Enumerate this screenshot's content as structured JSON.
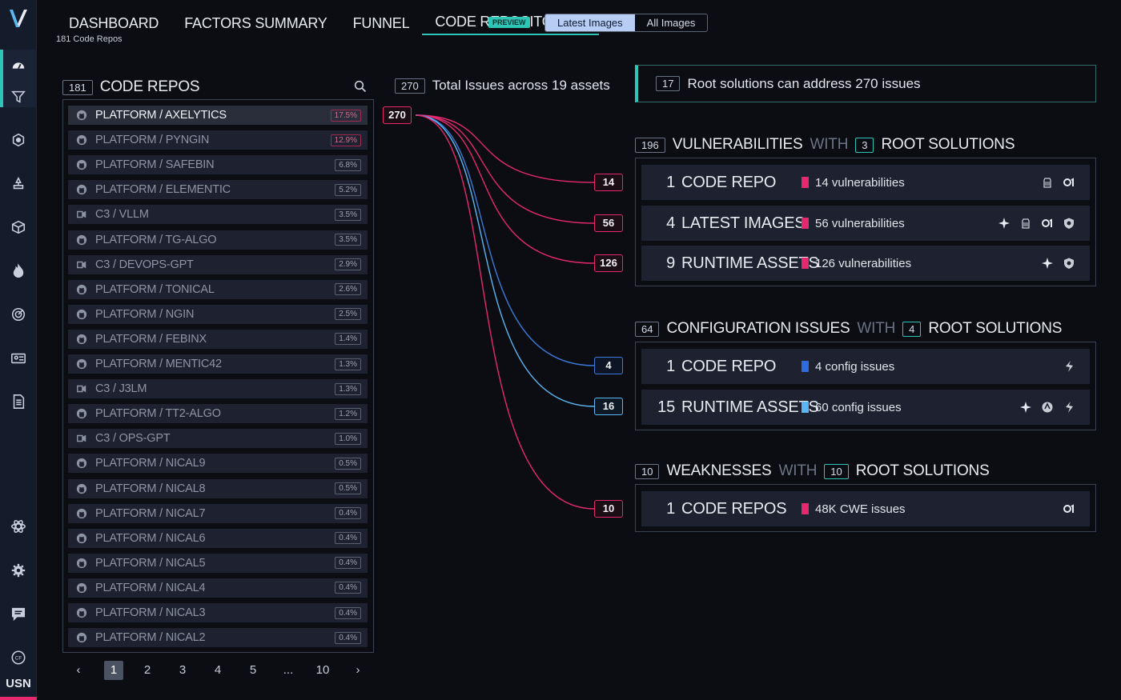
{
  "sidebar": {
    "logo": "V",
    "icons": [
      "dashboard-icon",
      "filter-icon",
      "cube-network-icon",
      "deploy-icon",
      "box-icon",
      "fire-icon",
      "radar-icon",
      "id-card-icon",
      "document-icon",
      "atom-icon",
      "gear-icon",
      "chat-icon",
      "cf-icon"
    ],
    "footer_label": "USN"
  },
  "nav": {
    "tabs": [
      "DASHBOARD",
      "FACTORS SUMMARY",
      "FUNNEL",
      "CODE REPOSITORIES"
    ],
    "active_tab": "CODE REPOSITORIES",
    "preview_badge": "PREVIEW",
    "toggle": [
      "Latest Images",
      "All Images"
    ],
    "toggle_active": "Latest Images",
    "subtitle": "181 Code Repos"
  },
  "repos": {
    "count": "181",
    "title": "CODE REPOS",
    "items": [
      {
        "name": "PLATFORM / AXELYTICS",
        "pct": "17.5%",
        "kind": "github"
      },
      {
        "name": "PLATFORM / PYNGIN",
        "pct": "12.9%",
        "kind": "github"
      },
      {
        "name": "PLATFORM / SAFEBIN",
        "pct": "6.8%",
        "kind": "github"
      },
      {
        "name": "PLATFORM / ELEMENTIC",
        "pct": "5.2%",
        "kind": "github"
      },
      {
        "name": "C3 / VLLM",
        "pct": "3.5%",
        "kind": "gitlab"
      },
      {
        "name": "PLATFORM / TG-ALGO",
        "pct": "3.5%",
        "kind": "github"
      },
      {
        "name": "C3 / DEVOPS-GPT",
        "pct": "2.9%",
        "kind": "gitlab"
      },
      {
        "name": "PLATFORM / TONICAL",
        "pct": "2.6%",
        "kind": "github"
      },
      {
        "name": "PLATFORM / NGIN",
        "pct": "2.5%",
        "kind": "github"
      },
      {
        "name": "PLATFORM / FEBINX",
        "pct": "1.4%",
        "kind": "github"
      },
      {
        "name": "PLATFORM / MENTIC42",
        "pct": "1.3%",
        "kind": "github"
      },
      {
        "name": "C3 / J3LM",
        "pct": "1.3%",
        "kind": "gitlab"
      },
      {
        "name": "PLATFORM / TT2-ALGO",
        "pct": "1.2%",
        "kind": "github"
      },
      {
        "name": "C3 / OPS-GPT",
        "pct": "1.0%",
        "kind": "gitlab"
      },
      {
        "name": "PLATFORM / NICAL9",
        "pct": "0.5%",
        "kind": "github"
      },
      {
        "name": "PLATFORM / NICAL8",
        "pct": "0.5%",
        "kind": "github"
      },
      {
        "name": "PLATFORM / NICAL7",
        "pct": "0.4%",
        "kind": "github"
      },
      {
        "name": "PLATFORM / NICAL6",
        "pct": "0.4%",
        "kind": "github"
      },
      {
        "name": "PLATFORM / NICAL5",
        "pct": "0.4%",
        "kind": "github"
      },
      {
        "name": "PLATFORM / NICAL4",
        "pct": "0.4%",
        "kind": "github"
      },
      {
        "name": "PLATFORM / NICAL3",
        "pct": "0.4%",
        "kind": "github"
      },
      {
        "name": "PLATFORM / NICAL2",
        "pct": "0.4%",
        "kind": "github"
      }
    ],
    "pager": [
      "‹",
      "1",
      "2",
      "3",
      "4",
      "5",
      "...",
      "10",
      "›"
    ],
    "pager_active": "1"
  },
  "flow": {
    "total_count": "270",
    "total_label": "Total Issues across 19 assets",
    "source": "270",
    "targets": [
      "14",
      "56",
      "126",
      "4",
      "16",
      "10"
    ]
  },
  "root": {
    "count": "17",
    "label": "Root solutions can address 270 issues"
  },
  "groups": [
    {
      "count": "196",
      "title": "VULNERABILITIES",
      "with": "WITH",
      "sol_count": "3",
      "sol_label": "ROOT SOLUTIONS",
      "rows": [
        {
          "num": "1",
          "name": "CODE REPO",
          "desc": "14 vulnerabilities",
          "color": "#e6286e",
          "icons": [
            "container-icon",
            "o1-icon"
          ]
        },
        {
          "num": "4",
          "name": "LATEST IMAGES",
          "desc": "56 vulnerabilities",
          "color": "#e6286e",
          "icons": [
            "sparkle-icon",
            "container-icon",
            "o1-icon",
            "shield-icon"
          ]
        },
        {
          "num": "9",
          "name": "RUNTIME ASSETS",
          "desc": "126 vulnerabilities",
          "color": "#e6286e",
          "icons": [
            "sparkle-icon",
            "shield-icon"
          ]
        }
      ]
    },
    {
      "count": "64",
      "title": "CONFIGURATION ISSUES",
      "with": "WITH",
      "sol_count": "4",
      "sol_label": "ROOT SOLUTIONS",
      "rows": [
        {
          "num": "1",
          "name": "CODE REPO",
          "desc": "4 config issues",
          "color": "#2f6be0",
          "icons": [
            "kite-icon"
          ]
        },
        {
          "num": "15",
          "name": "RUNTIME ASSETS",
          "desc": "60 config issues",
          "color": "#5bb6f2",
          "icons": [
            "sparkle-icon",
            "helm-icon",
            "kite-icon"
          ]
        }
      ]
    },
    {
      "count": "10",
      "title": "WEAKNESSES",
      "with": "WITH",
      "sol_count": "10",
      "sol_label": "ROOT SOLUTIONS",
      "rows": [
        {
          "num": "1",
          "name": "CODE REPOS",
          "desc": "48K CWE issues",
          "color": "#e6286e",
          "icons": [
            "o1-icon"
          ]
        }
      ]
    }
  ],
  "colors": {
    "accent": "#2ec4b6",
    "danger": "#e6286e",
    "blue": "#2f6be0",
    "light_blue": "#5bb6f2"
  }
}
